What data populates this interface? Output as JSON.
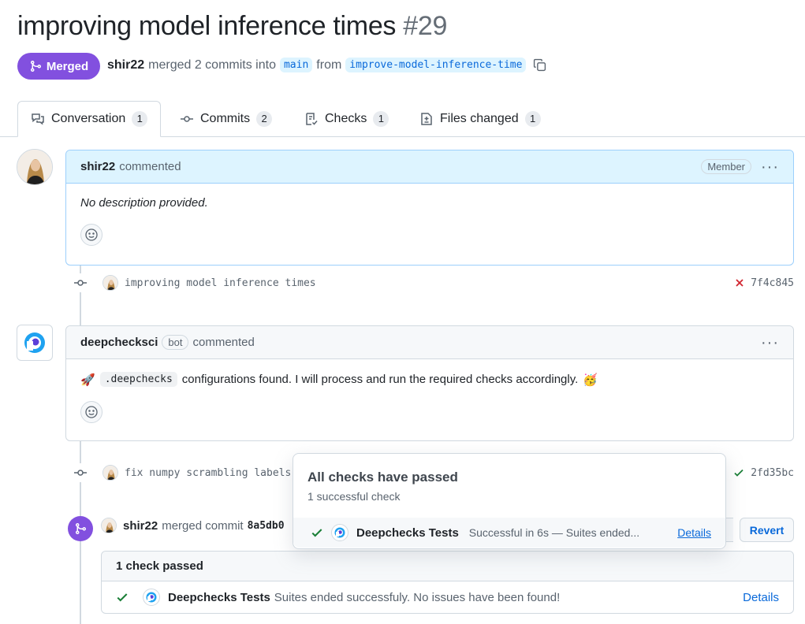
{
  "pr": {
    "title": "improving model inference times",
    "number": "#29",
    "state": "Merged",
    "author": "shir22",
    "merge_text": "merged 2 commits into",
    "base_branch": "main",
    "from_text": "from",
    "head_branch": "improve-model-inference-time"
  },
  "tabs": [
    {
      "label": "Conversation",
      "count": "1",
      "icon": "conversation-icon"
    },
    {
      "label": "Commits",
      "count": "2",
      "icon": "commit-icon"
    },
    {
      "label": "Checks",
      "count": "1",
      "icon": "checklist-icon"
    },
    {
      "label": "Files changed",
      "count": "1",
      "icon": "file-diff-icon"
    }
  ],
  "comment1": {
    "author": "shir22",
    "action": "commented",
    "badge": "Member",
    "body": "No description provided."
  },
  "commit1": {
    "message": "improving model inference times",
    "status": "failure",
    "sha": "7f4c845"
  },
  "comment2": {
    "author": "deepchecksci",
    "badge": "bot",
    "action": "commented",
    "emoji_prefix": "🚀",
    "code": ".deepchecks",
    "body": "configurations found. I will process and run the required checks accordingly.",
    "emoji_suffix": "🥳"
  },
  "commit2": {
    "message": "fix numpy scrambling labels",
    "status": "success",
    "sha": "2fd35bc"
  },
  "merge_event": {
    "author": "shir22",
    "text": "merged commit",
    "sha": "8a5db0",
    "revert_label": "Revert"
  },
  "checks_box": {
    "header": "1 check passed",
    "name": "Deepchecks Tests",
    "description": "Suites ended successfuly. No issues have been found!",
    "details_label": "Details"
  },
  "popover": {
    "title": "All checks have passed",
    "subtitle": "1 successful check",
    "name": "Deepchecks Tests",
    "description": "Successful in 6s — Suites ended...",
    "details_label": "Details"
  },
  "colors": {
    "merged": "#8250df",
    "link": "#0969da",
    "success": "#1a7f37",
    "failure": "#d1242f"
  }
}
